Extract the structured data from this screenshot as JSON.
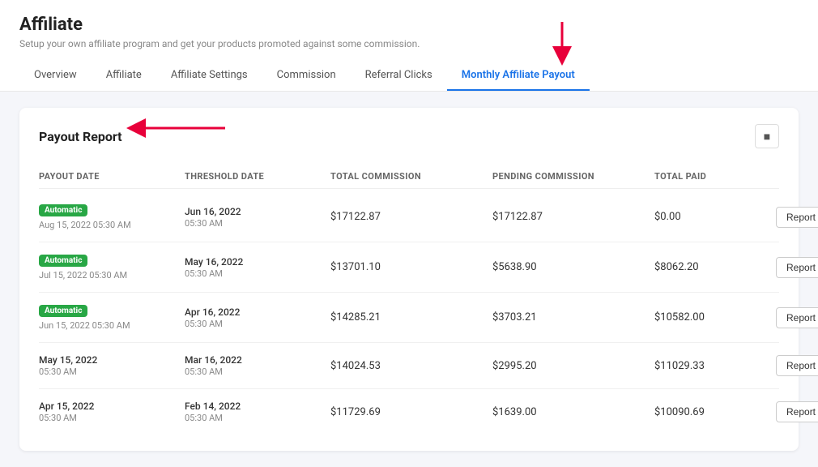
{
  "page": {
    "title": "Affiliate",
    "subtitle": "Setup your own affiliate program and get your products promoted against some commission."
  },
  "tabs": [
    {
      "id": "overview",
      "label": "Overview",
      "active": false
    },
    {
      "id": "affiliate",
      "label": "Affiliate",
      "active": false
    },
    {
      "id": "affiliate-settings",
      "label": "Affiliate Settings",
      "active": false
    },
    {
      "id": "commission",
      "label": "Commission",
      "active": false
    },
    {
      "id": "referral-clicks",
      "label": "Referral Clicks",
      "active": false
    },
    {
      "id": "monthly-affiliate-payout",
      "label": "Monthly Affiliate Payout",
      "active": true
    }
  ],
  "card": {
    "title": "Payout Report",
    "icon": "■"
  },
  "table": {
    "columns": [
      "PAYOUT DATE",
      "THRESHOLD DATE",
      "TOTAL COMMISSION",
      "PENDING COMMISSION",
      "TOTAL PAID",
      ""
    ],
    "rows": [
      {
        "payout_badge": "Automatic",
        "payout_date": "Aug 15, 2022 05:30 AM",
        "threshold_date": "Jun 16, 2022",
        "threshold_time": "05:30 AM",
        "total_commission": "$17122.87",
        "pending_commission": "$17122.87",
        "total_paid": "$0.00",
        "btn_label": "Report Details"
      },
      {
        "payout_badge": "Automatic",
        "payout_date": "Jul 15, 2022 05:30 AM",
        "threshold_date": "May 16, 2022",
        "threshold_time": "05:30 AM",
        "total_commission": "$13701.10",
        "pending_commission": "$5638.90",
        "total_paid": "$8062.20",
        "btn_label": "Report Details"
      },
      {
        "payout_badge": "Automatic",
        "payout_date": "Jun 15, 2022 05:30 AM",
        "threshold_date": "Apr 16, 2022",
        "threshold_time": "05:30 AM",
        "total_commission": "$14285.21",
        "pending_commission": "$3703.21",
        "total_paid": "$10582.00",
        "btn_label": "Report Details"
      },
      {
        "payout_badge": null,
        "payout_date": "May 15, 2022",
        "payout_date2": "05:30 AM",
        "threshold_date": "Mar 16, 2022",
        "threshold_time": "05:30 AM",
        "total_commission": "$14024.53",
        "pending_commission": "$2995.20",
        "total_paid": "$11029.33",
        "btn_label": "Report Details"
      },
      {
        "payout_badge": null,
        "payout_date": "Apr 15, 2022",
        "payout_date2": "05:30 AM",
        "threshold_date": "Feb 14, 2022",
        "threshold_time": "05:30 AM",
        "total_commission": "$11729.69",
        "pending_commission": "$1639.00",
        "total_paid": "$10090.69",
        "btn_label": "Report Details"
      }
    ]
  }
}
